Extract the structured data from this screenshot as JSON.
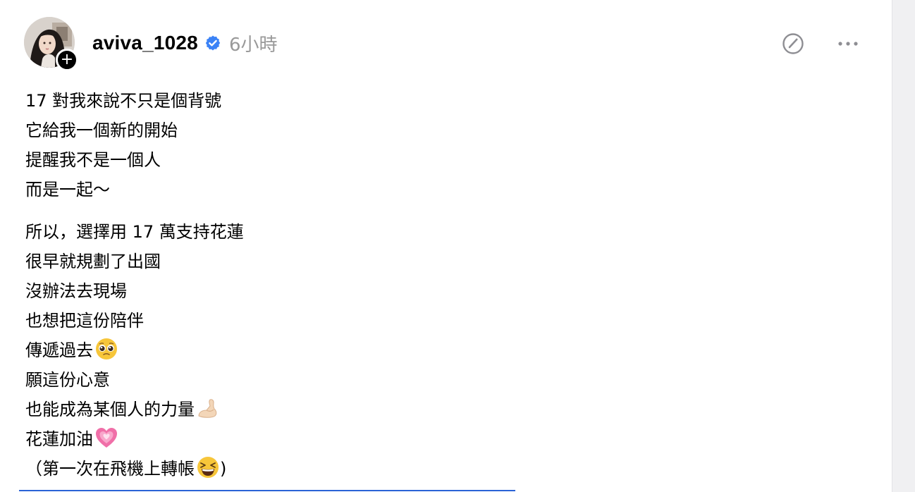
{
  "post": {
    "author": {
      "username": "aviva_1028",
      "verified": true,
      "time_ago": "6小時",
      "follow_symbol": "+"
    },
    "paragraphs": [
      [
        "17 對我來說不只是個背號",
        "它給我一個新的開始",
        "提醒我不是一個人",
        "而是一起～"
      ],
      [
        "所以，選擇用 17 萬支持花蓮",
        "很早就規劃了出國",
        "沒辦法去現場",
        "也想把這份陪伴",
        "傳遞過去",
        "願這份心意",
        "也能成為某個人的力量",
        "花蓮加油",
        "（第一次在飛機上轉帳",
        ")"
      ]
    ],
    "emoji_names": {
      "line_5": "pleading-face-emoji",
      "line_7": "flexed-biceps-emoji",
      "line_8": "growing-heart-emoji",
      "line_9": "grinning-squinting-face-emoji"
    }
  },
  "colors": {
    "verified_blue": "#3b82f6",
    "time_gray": "#999999",
    "icon_gray": "#8e8e93",
    "focus_blue": "#2a63d6"
  },
  "icons": {
    "edit": "pencil-circle-icon",
    "more": "ellipsis-icon"
  }
}
